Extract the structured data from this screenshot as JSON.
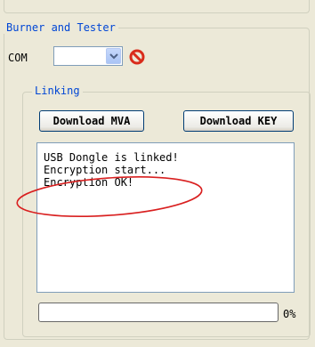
{
  "groups": {
    "outer": {
      "label": "Burner and Tester"
    },
    "linking": {
      "label": "Linking"
    }
  },
  "com": {
    "label": "COM",
    "selected": ""
  },
  "buttons": {
    "download_mva": "Download MVA",
    "download_key": "Download KEY"
  },
  "log": {
    "lines": [
      "USB Dongle is linked!",
      "Encryption start...",
      "Encryption OK!"
    ]
  },
  "progress": {
    "value": 0,
    "text": "0%"
  },
  "colors": {
    "legend": "#0046d5",
    "annotation": "#d92020",
    "stop_icon": "#d92c1c"
  },
  "icons": {
    "stop": "no-entry-icon",
    "dropdown": "chevron-down-icon"
  }
}
